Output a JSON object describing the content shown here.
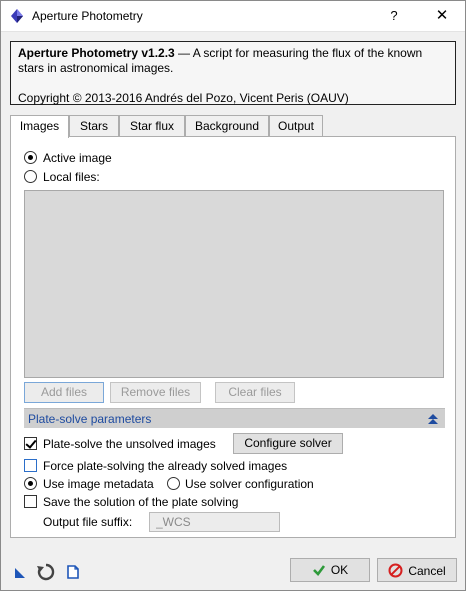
{
  "window": {
    "title": "Aperture Photometry",
    "help_label": "?",
    "close_label": "✕"
  },
  "info": {
    "name": "Aperture Photometry v1.2.3",
    "description": " — A script for measuring the flux of the known stars in astronomical images.",
    "copyright": "Copyright © 2013-2016 Andrés del Pozo, Vicent Peris (OAUV)"
  },
  "tabs": [
    {
      "label": "Images",
      "active": true
    },
    {
      "label": "Stars",
      "active": false
    },
    {
      "label": "Star flux",
      "active": false
    },
    {
      "label": "Background",
      "active": false
    },
    {
      "label": "Output",
      "active": false
    }
  ],
  "images": {
    "active_image_label": "Active image",
    "active_image_selected": true,
    "local_files_label": "Local files:",
    "local_files_selected": false,
    "add_files_label": "Add files",
    "remove_files_label": "Remove files",
    "clear_files_label": "Clear files"
  },
  "plate_solve": {
    "section_title": "Plate-solve parameters",
    "solve_unsolved_label": "Plate-solve the unsolved images",
    "solve_unsolved_checked": true,
    "configure_solver_label": "Configure solver",
    "force_solving_label": "Force plate-solving the already solved images",
    "force_solving_checked": false,
    "use_metadata_label": "Use image metadata",
    "use_metadata_selected": true,
    "use_solver_config_label": "Use solver configuration",
    "use_solver_config_selected": false,
    "save_solution_label": "Save the solution of the plate solving",
    "save_solution_checked": false,
    "suffix_label": "Output file suffix:",
    "suffix_value": "_WCS"
  },
  "footer": {
    "ok_label": "OK",
    "cancel_label": "Cancel"
  },
  "colors": {
    "section_text": "#1e4ba0",
    "ok_check": "#2e9a3a",
    "cancel_icon": "#d61f1f"
  }
}
